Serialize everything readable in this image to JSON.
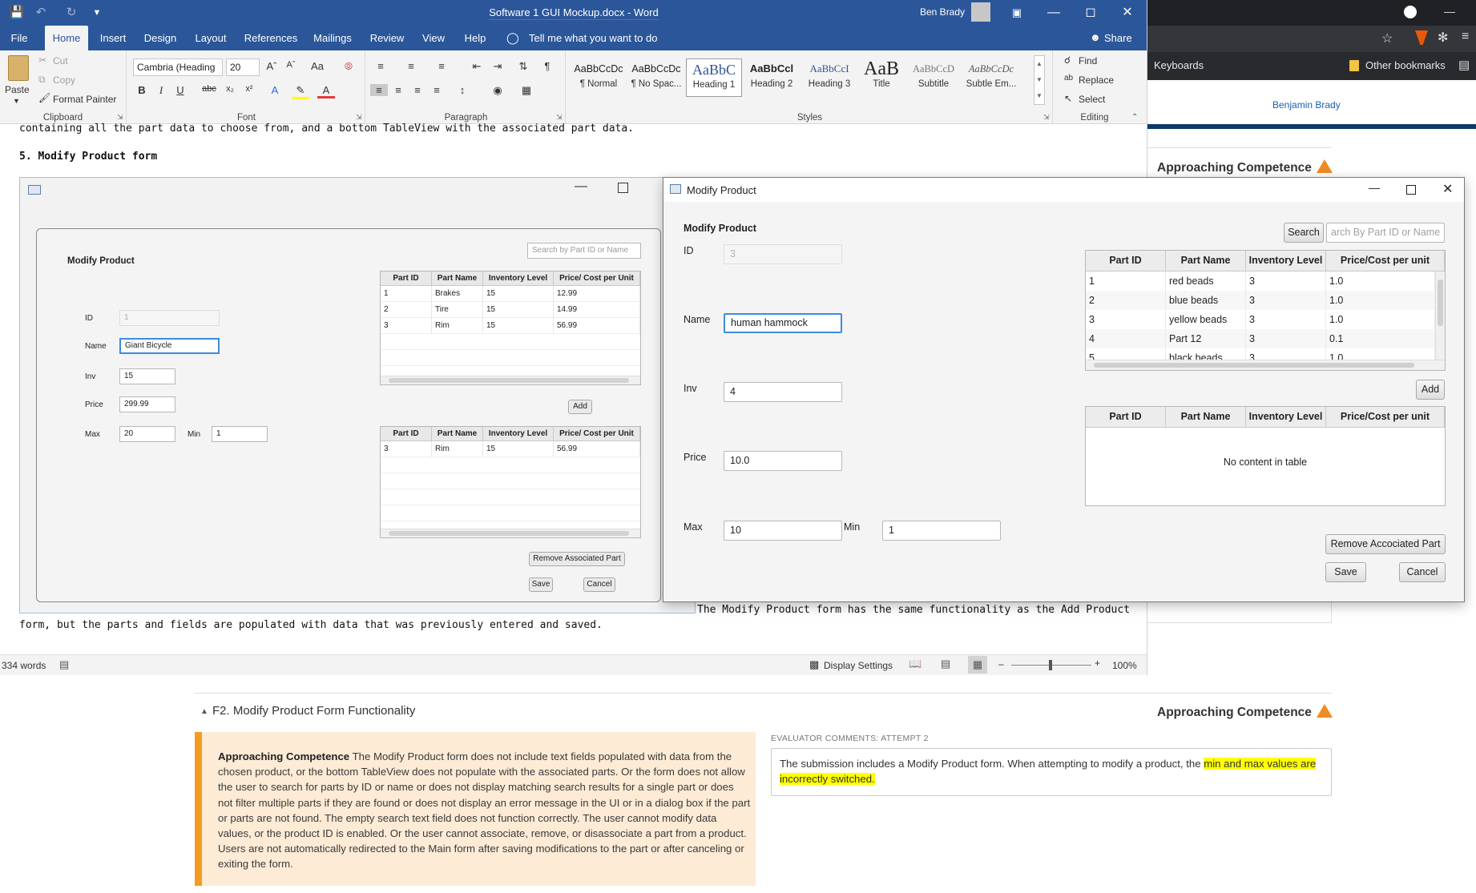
{
  "word": {
    "title": "Software 1 GUI Mockup.docx  -  Word",
    "user": "Ben Brady",
    "tabs": [
      "File",
      "Home",
      "Insert",
      "Design",
      "Layout",
      "References",
      "Mailings",
      "Review",
      "View",
      "Help"
    ],
    "tell_me": "Tell me what you want to do",
    "share": "Share",
    "clipboard": {
      "paste": "Paste",
      "cut": "Cut",
      "copy": "Copy",
      "format_painter": "Format Painter",
      "group": "Clipboard"
    },
    "font": {
      "name": "Cambria (Heading",
      "size": "20",
      "group": "Font",
      "case_label": "Aa"
    },
    "paragraph": {
      "group": "Paragraph"
    },
    "styles": {
      "group": "Styles",
      "items": [
        {
          "preview": "AaBbCcDc",
          "name": "¶ Normal"
        },
        {
          "preview": "AaBbCcDc",
          "name": "¶ No Spac..."
        },
        {
          "preview": "AaBbC",
          "name": "Heading 1"
        },
        {
          "preview": "AaBbCcl",
          "name": "Heading 2"
        },
        {
          "preview": "AaBbCcI",
          "name": "Heading 3"
        },
        {
          "preview": "AaB",
          "name": "Title"
        },
        {
          "preview": "AaBbCcD",
          "name": "Subtitle"
        },
        {
          "preview": "AaBbCcDc",
          "name": "Subtle Em..."
        }
      ]
    },
    "editing": {
      "find": "Find",
      "replace": "Replace",
      "select": "Select",
      "group": "Editing"
    },
    "status": {
      "words": "334 words",
      "display_settings": "Display Settings",
      "zoom": "100%"
    }
  },
  "document": {
    "top_line": "containing all the part data to choose from, and a bottom TableView with the associated part data.",
    "heading": "5. Modify Product form",
    "after_text_1": "The Modify Product form has the same functionality as the Add Product",
    "after_text_2": "form, but the parts and fields are populated with data that was previously entered and saved."
  },
  "mockup": {
    "title": "Modify Product",
    "search_placeholder": "Search by Part ID or Name",
    "labels": {
      "id": "ID",
      "name": "Name",
      "inv": "Inv",
      "price": "Price",
      "max": "Max",
      "min": "Min"
    },
    "values": {
      "id": "1",
      "name": "Giant Bicycle",
      "inv": "15",
      "price": "299.99",
      "max": "20",
      "min": "1"
    },
    "columns": [
      "Part ID",
      "Part Name",
      "Inventory Level",
      "Price/ Cost per Unit"
    ],
    "top_rows": [
      [
        "1",
        "Brakes",
        "15",
        "12.99"
      ],
      [
        "2",
        "Tire",
        "15",
        "14.99"
      ],
      [
        "3",
        "Rim",
        "15",
        "56.99"
      ]
    ],
    "bottom_rows": [
      [
        "3",
        "Rim",
        "15",
        "56.99"
      ]
    ],
    "add": "Add",
    "remove": "Remove Associated Part",
    "save": "Save",
    "cancel": "Cancel"
  },
  "chrome": {
    "bookmark_1": "Keyboards",
    "bookmark_2": "Other bookmarks",
    "user_link": "Benjamin Brady",
    "competence_top": "Approaching Competence"
  },
  "fx": {
    "window_title": "Modify Product",
    "heading": "Modify Product",
    "labels": {
      "id": "ID",
      "name": "Name",
      "inv": "Inv",
      "price": "Price",
      "max": "Max",
      "min": "Min"
    },
    "values": {
      "id": "3",
      "name": "human hammock",
      "inv": "4",
      "price": "10.0",
      "max": "10",
      "min": "1"
    },
    "search_button": "Search",
    "search_placeholder": "arch By Part ID  or Name",
    "columns": [
      "Part ID",
      "Part Name",
      "Inventory Level",
      "Price/Cost per unit"
    ],
    "top_rows": [
      [
        "1",
        "red beads",
        "3",
        "1.0"
      ],
      [
        "2",
        "blue beads",
        "3",
        "1.0"
      ],
      [
        "3",
        "yellow beads",
        "3",
        "1.0"
      ],
      [
        "4",
        "Part 12",
        "3",
        "0.1"
      ],
      [
        "5",
        "black beads",
        "3",
        "1.0"
      ]
    ],
    "empty_text": "No content in table",
    "add": "Add",
    "remove": "Remove Accociated Part",
    "save": "Save",
    "cancel": "Cancel"
  },
  "rubric": {
    "section": "F2. Modify Product Form Functionality",
    "competence": "Approaching Competence",
    "box_title": "Approaching Competence",
    "box_text": "The Modify Product form does not include text fields populated with data from the chosen product, or the bottom TableView does not populate with the associated parts. Or the form does not allow the user to search for parts by ID or name or does not display matching search results for a single part or does not filter multiple parts if they are found or does not display an error message in the UI or in a dialog box if the part or parts are not found. The empty search text field does not function correctly. The user cannot modify data values, or the product ID is enabled. Or the user cannot associate, remove, or disassociate a part from a product. Users are not automatically redirected to the Main form after saving modifications to the part or after canceling or exiting the form.",
    "evaluator_heading": "EVALUATOR COMMENTS: ATTEMPT 2",
    "comment_before": "The submission includes a Modify Product form. When attempting to modify a product, the ",
    "comment_highlight": "min and max values are incorrectly switched."
  }
}
